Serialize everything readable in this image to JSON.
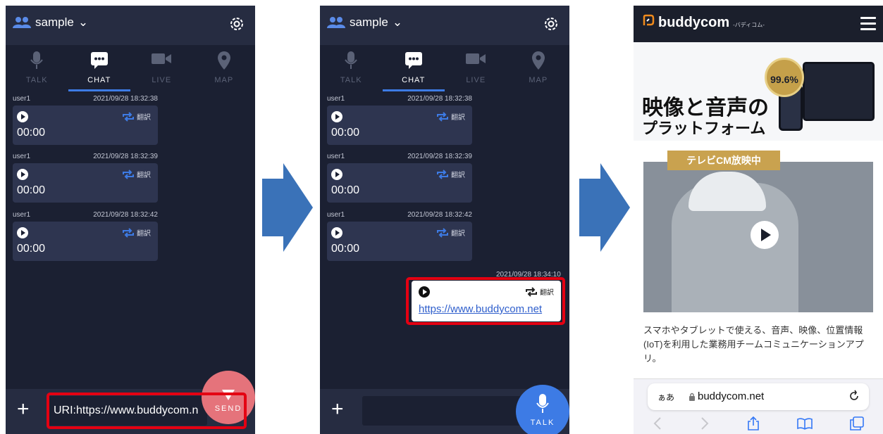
{
  "chat": {
    "group": "sample",
    "tabs": [
      "TALK",
      "CHAT",
      "LIVE",
      "MAP"
    ],
    "messages": [
      {
        "user": "user1",
        "ts": "2021/09/28 18:32:38",
        "duration": "00:00",
        "translate": "翻訳"
      },
      {
        "user": "user1",
        "ts": "2021/09/28 18:32:39",
        "duration": "00:00",
        "translate": "翻訳"
      },
      {
        "user": "user1",
        "ts": "2021/09/28 18:32:42",
        "duration": "00:00",
        "translate": "翻訳"
      }
    ],
    "input_value": "URI:https://www.buddycom.n",
    "send_label": "SEND",
    "talk_label": "TALK",
    "sent": {
      "ts": "2021/09/28 18:34:10",
      "translate": "翻訳",
      "link": "https://www.buddycom.net"
    }
  },
  "colors": {
    "accent": "#3d7be5",
    "highlight": "#e40012",
    "send": "#e5737b",
    "arrow": "#3a72b8"
  },
  "browser": {
    "brand": "buddycom",
    "brand_sub": "-バディコム-",
    "badge": "99.6%",
    "headline1": "映像と音声の",
    "headline2": "プラットフォーム",
    "cm_label": "テレビCM放映中",
    "description": "スマホやタブレットで使える、音声、映像、位置情報(IoT)を利用した業務用チームコミュニケーションアプリ。",
    "address_aa": "ぁあ",
    "address_url": "buddycom.net"
  }
}
